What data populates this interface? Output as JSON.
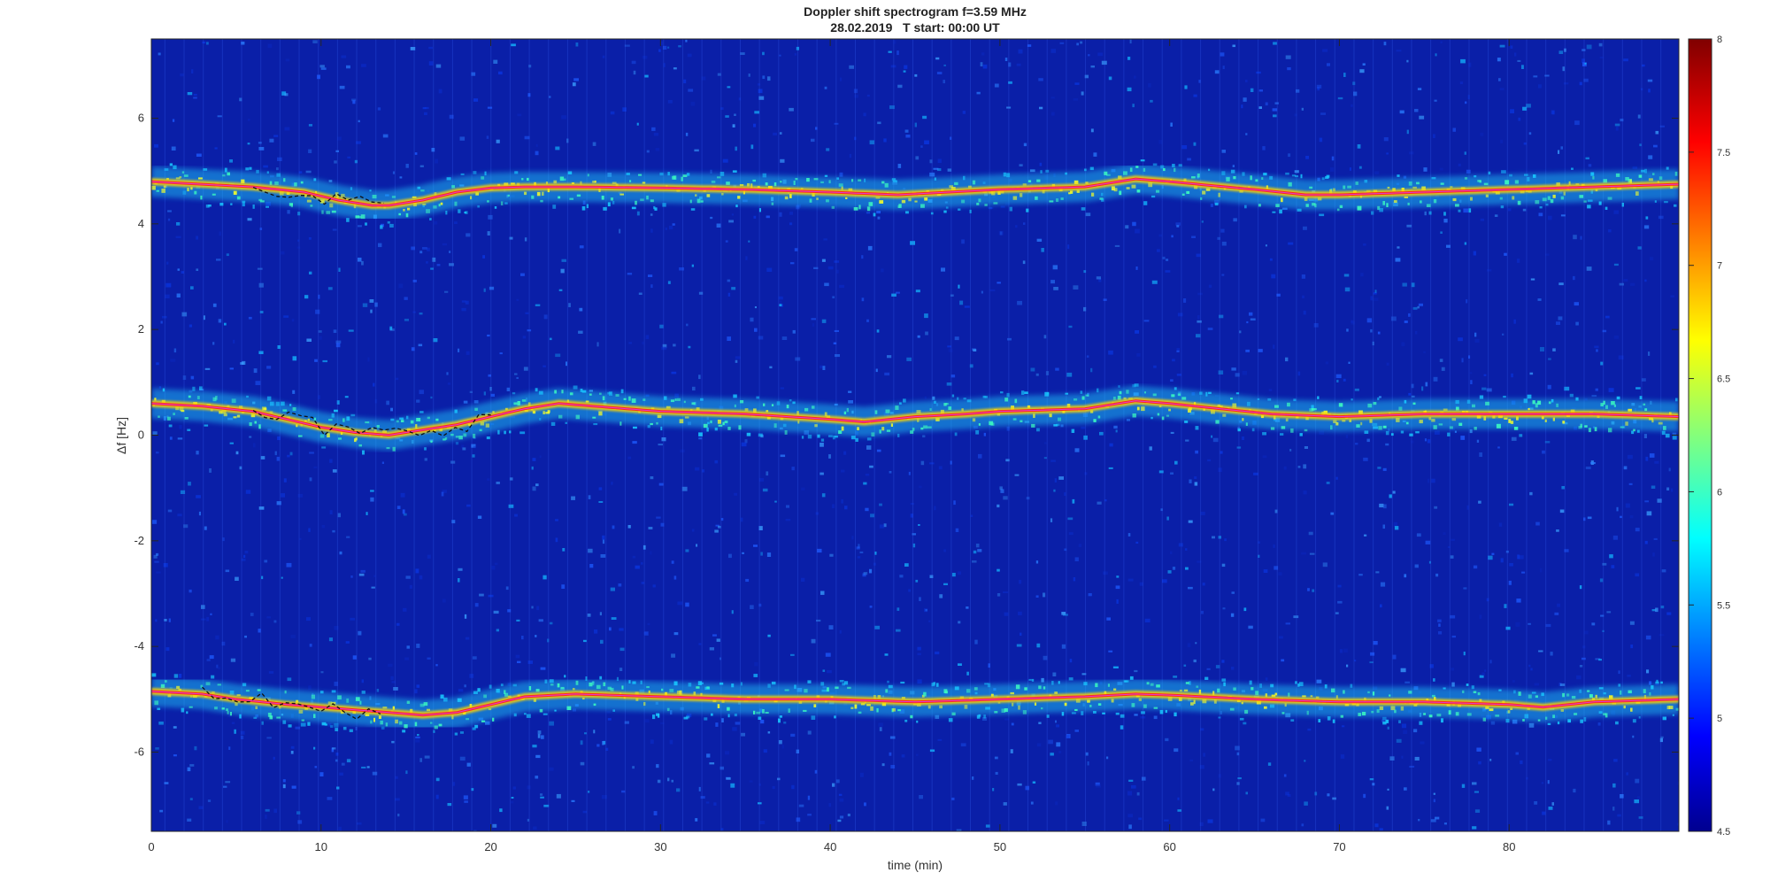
{
  "chart_data": {
    "type": "heatmap",
    "title": "Doppler shift spectrogram f=3.59 MHz",
    "subtitle": "28.02.2019   T start: 00:00 UT",
    "xlabel": "time (min)",
    "ylabel": "Δf [Hz]",
    "xlim": [
      0,
      90
    ],
    "ylim": [
      -7.5,
      7.5
    ],
    "xticks": [
      0,
      10,
      20,
      30,
      40,
      50,
      60,
      70,
      80
    ],
    "yticks": [
      -6,
      -4,
      -2,
      0,
      2,
      4,
      6
    ],
    "colormap": "jet",
    "colorbar": {
      "range": [
        4.5,
        8
      ],
      "ticks": [
        4.5,
        5,
        5.5,
        6,
        6.5,
        7,
        7.5,
        8
      ]
    },
    "background_color": "#0a1fa8",
    "traces": [
      {
        "name": "",
        "time_min": [
          0,
          3,
          6,
          9,
          11,
          12,
          13,
          14,
          16,
          18,
          20,
          22,
          25,
          30,
          35,
          40,
          44,
          47,
          50,
          55,
          58,
          60,
          65,
          68,
          70,
          75,
          80,
          85,
          90
        ],
        "df_hz": [
          4.8,
          4.75,
          4.7,
          4.6,
          4.45,
          4.4,
          4.35,
          4.35,
          4.45,
          4.6,
          4.68,
          4.7,
          4.7,
          4.68,
          4.65,
          4.6,
          4.55,
          4.6,
          4.65,
          4.7,
          4.85,
          4.8,
          4.65,
          4.55,
          4.55,
          4.6,
          4.65,
          4.7,
          4.75
        ]
      },
      {
        "name": "",
        "time_min": [
          0,
          3,
          6,
          8,
          10,
          12,
          14,
          16,
          18,
          20,
          22,
          24,
          26,
          30,
          35,
          40,
          42,
          45,
          48,
          50,
          55,
          58,
          60,
          63,
          66,
          70,
          75,
          80,
          85,
          90
        ],
        "df_hz": [
          0.6,
          0.55,
          0.45,
          0.3,
          0.15,
          0.05,
          0.0,
          0.1,
          0.2,
          0.35,
          0.5,
          0.6,
          0.55,
          0.45,
          0.4,
          0.3,
          0.25,
          0.35,
          0.4,
          0.45,
          0.5,
          0.65,
          0.6,
          0.5,
          0.4,
          0.35,
          0.4,
          0.4,
          0.4,
          0.35
        ]
      },
      {
        "name": "",
        "time_min": [
          0,
          3,
          5,
          8,
          10,
          12,
          14,
          16,
          18,
          20,
          22,
          25,
          30,
          35,
          40,
          45,
          50,
          55,
          58,
          60,
          65,
          70,
          75,
          80,
          82,
          85,
          90
        ],
        "df_hz": [
          -4.85,
          -4.9,
          -5.0,
          -5.1,
          -5.15,
          -5.2,
          -5.25,
          -5.3,
          -5.25,
          -5.1,
          -4.95,
          -4.9,
          -4.95,
          -5.0,
          -5.0,
          -5.05,
          -5.0,
          -4.95,
          -4.9,
          -4.92,
          -5.0,
          -5.05,
          -5.05,
          -5.1,
          -5.15,
          -5.05,
          -5.0
        ]
      }
    ],
    "annotations": "black dashed tracking segments near 8-14 min on upper and middle bands"
  }
}
